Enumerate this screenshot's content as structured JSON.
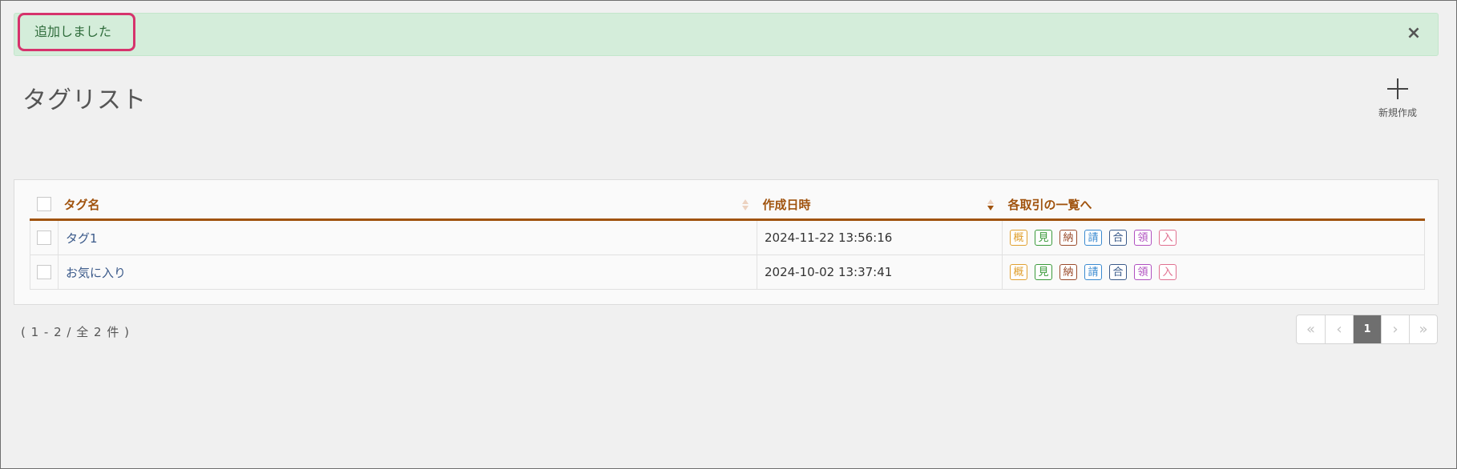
{
  "alert": {
    "message": "追加しました",
    "close_label": "×"
  },
  "page": {
    "title": "タグリスト"
  },
  "toolbar": {
    "new_label": "新規作成"
  },
  "table": {
    "headers": {
      "tag_name": "タグ名",
      "created_at": "作成日時",
      "links": "各取引の一覧へ"
    },
    "rows": [
      {
        "name": "タグ1",
        "created_at": "2024-11-22 13:56:16"
      },
      {
        "name": "お気に入り",
        "created_at": "2024-10-02 13:37:41"
      }
    ],
    "badges": [
      {
        "label": "概",
        "color": "#e0a030"
      },
      {
        "label": "見",
        "color": "#3a9a3a"
      },
      {
        "label": "納",
        "color": "#9a4a2a"
      },
      {
        "label": "請",
        "color": "#3a8ad0"
      },
      {
        "label": "合",
        "color": "#3a5a8a"
      },
      {
        "label": "領",
        "color": "#b050c0"
      },
      {
        "label": "入",
        "color": "#e07090"
      }
    ]
  },
  "footer": {
    "count": "( 1 - 2 / 全 2 件 )"
  },
  "pagination": {
    "first": "«",
    "prev": "‹",
    "current": "1",
    "next": "›",
    "last": "»"
  },
  "colors": {
    "accent": "#a0530e",
    "alert_bg": "#d4edda",
    "highlight_border": "#d6336c"
  }
}
